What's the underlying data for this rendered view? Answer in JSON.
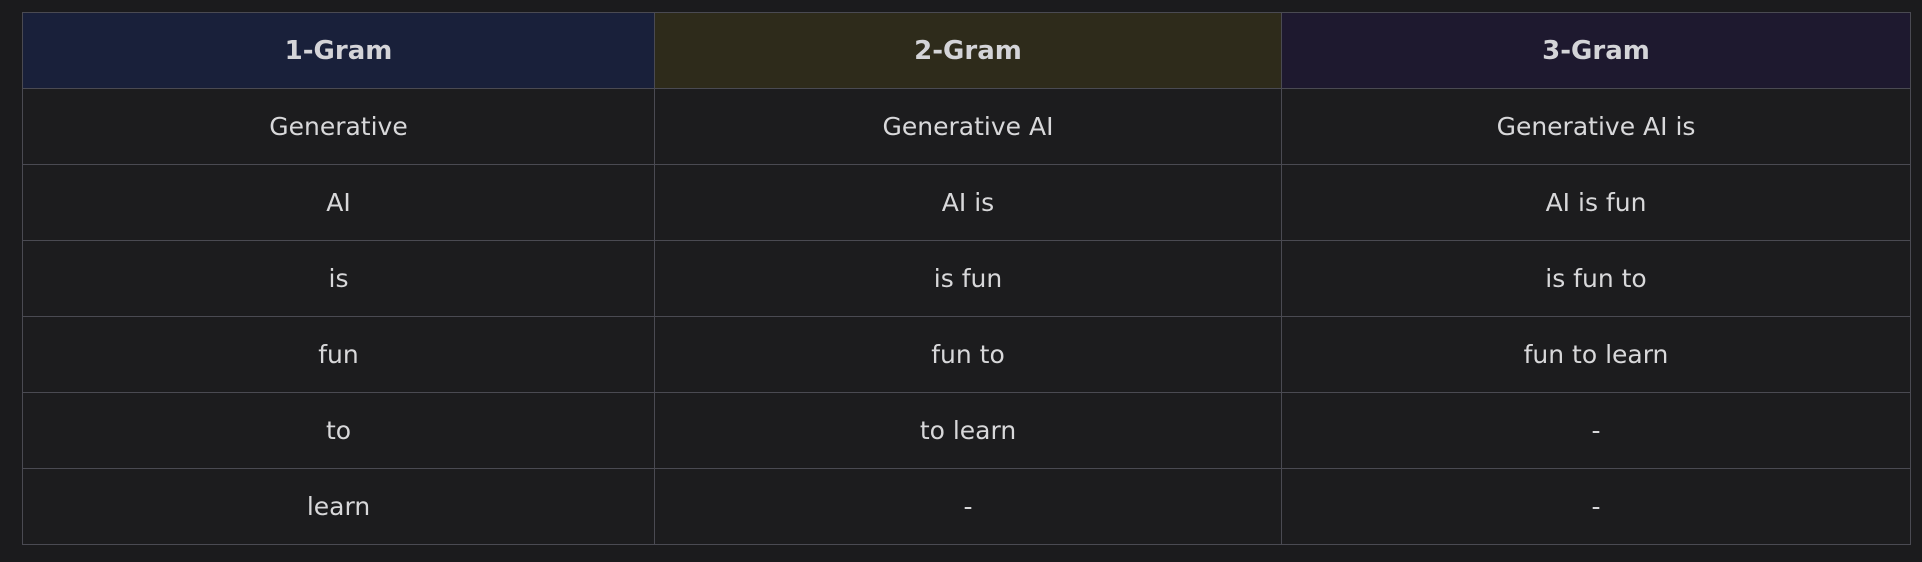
{
  "table": {
    "columns": [
      {
        "label": "1-Gram",
        "bg": "#19203a"
      },
      {
        "label": "2-Gram",
        "bg": "#2e2b1b"
      },
      {
        "label": "3-Gram",
        "bg": "#1e192f"
      }
    ],
    "rows": [
      [
        "Generative",
        "Generative AI",
        "Generative AI is"
      ],
      [
        "AI",
        "AI is",
        "AI is fun"
      ],
      [
        "is",
        "is fun",
        "is fun to"
      ],
      [
        "fun",
        "fun to",
        "fun to learn"
      ],
      [
        "to",
        "to learn",
        "-"
      ],
      [
        "learn",
        "-",
        "-"
      ]
    ]
  },
  "colors": {
    "page_background": "#1b1b1d",
    "cell_background": "#1c1c1e",
    "border": "#4a4a52",
    "text": "#d8d8da"
  }
}
